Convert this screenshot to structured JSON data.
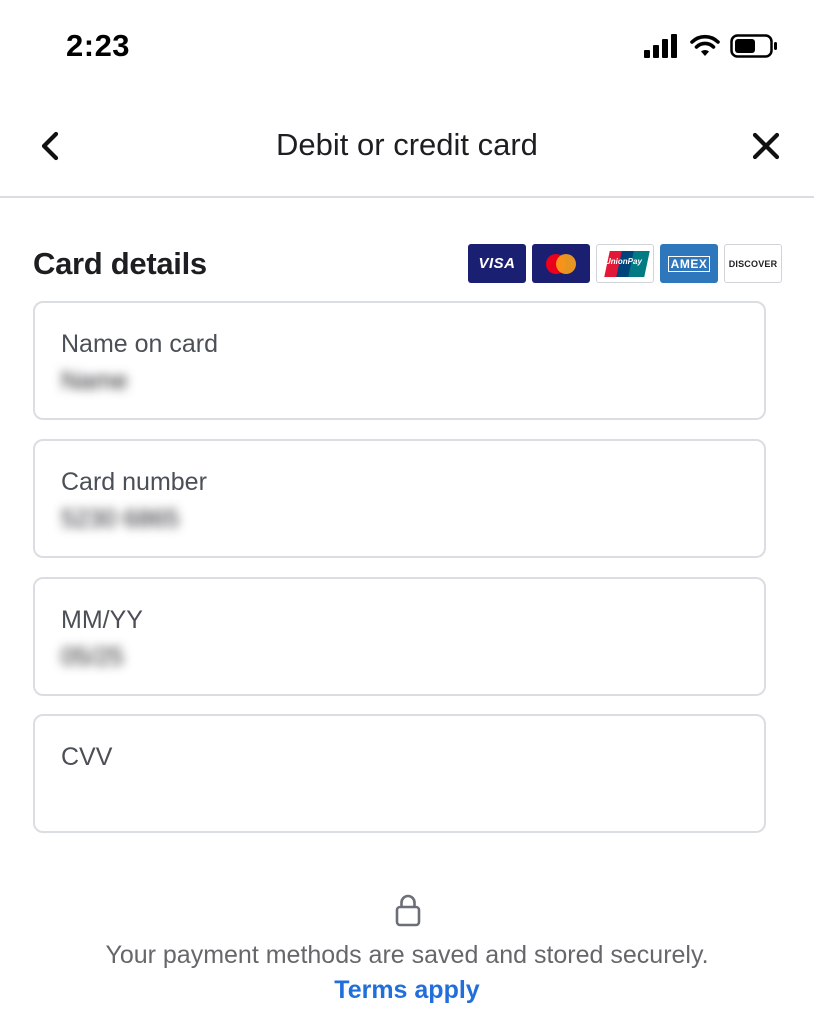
{
  "status_bar": {
    "time": "2:23",
    "icons": [
      "signal-icon",
      "wifi-icon",
      "battery-icon"
    ]
  },
  "header": {
    "title": "Debit or credit card",
    "back_icon": "chevron-left-icon",
    "close_icon": "close-icon"
  },
  "card_details": {
    "title": "Card details",
    "brands": [
      {
        "name": "visa-logo",
        "text": "VISA"
      },
      {
        "name": "mastercard-logo"
      },
      {
        "name": "unionpay-logo",
        "text": "UnionPay"
      },
      {
        "name": "amex-logo",
        "text": "AMEX"
      },
      {
        "name": "discover-logo",
        "text": "DISCOVER"
      }
    ]
  },
  "fields": [
    {
      "label": "Name on card",
      "value": "Name"
    },
    {
      "label": "Card number",
      "value": "5230 6865"
    },
    {
      "label": "MM/YY",
      "value": "05/25"
    },
    {
      "label": "CVV",
      "value": ""
    }
  ],
  "footer": {
    "lock_icon": "lock-icon",
    "secure_text": "Your payment methods are saved and stored securely.",
    "terms_link": "Terms apply"
  },
  "colors": {
    "link": "#216fdb",
    "border": "#dadde1",
    "text": "#1c1e21",
    "muted": "#65676b"
  }
}
